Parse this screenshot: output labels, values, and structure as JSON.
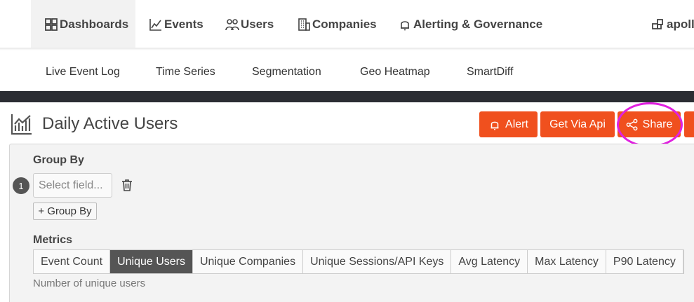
{
  "topnav": {
    "dashboards": "Dashboards",
    "events": "Events",
    "users": "Users",
    "companies": "Companies",
    "alerting": "Alerting & Governance",
    "org": "apollo"
  },
  "subnav": [
    "Live Event Log",
    "Time Series",
    "Segmentation",
    "Geo Heatmap",
    "SmartDiff"
  ],
  "page": {
    "title": "Daily Active Users",
    "buttons": {
      "alert": "Alert",
      "api": "Get Via Api",
      "share": "Share"
    }
  },
  "group_by": {
    "label": "Group By",
    "step": "1",
    "placeholder": "Select field...",
    "add_label": "+ Group By"
  },
  "metrics": {
    "label": "Metrics",
    "tabs": [
      "Event Count",
      "Unique Users",
      "Unique Companies",
      "Unique Sessions/API Keys",
      "Avg Latency",
      "Max Latency",
      "P90 Latency"
    ],
    "active_tab": "Unique Users",
    "description": "Number of unique users"
  },
  "colors": {
    "accent": "#f0501e",
    "highlight": "#e020e0",
    "dark_bar": "#2b2d33"
  }
}
